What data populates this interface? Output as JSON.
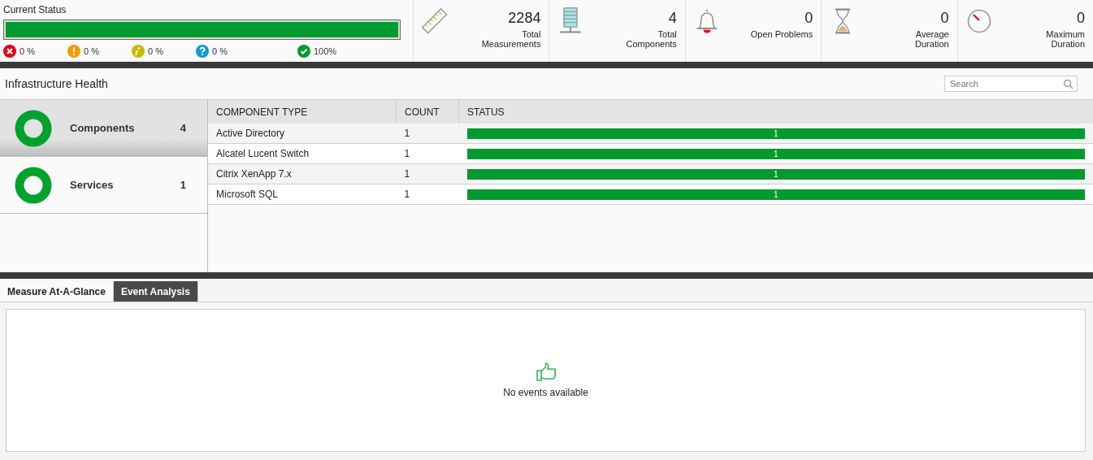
{
  "current_status": {
    "title": "Current Status",
    "level": 1,
    "legend": [
      {
        "kind": "critical",
        "text": "0 %"
      },
      {
        "kind": "major",
        "text": "0 %"
      },
      {
        "kind": "minor",
        "text": "0 %"
      },
      {
        "kind": "unknown",
        "text": "0 %"
      },
      {
        "kind": "normal",
        "text": "100%"
      }
    ]
  },
  "stats": [
    {
      "kind": "ruler",
      "value": "2284",
      "label": "Total Measurements"
    },
    {
      "kind": "server",
      "value": "4",
      "label": "Total Components"
    },
    {
      "kind": "bell",
      "value": "0",
      "label": "Open Problems"
    },
    {
      "kind": "hourglass",
      "value": "0",
      "label": "Average Duration"
    },
    {
      "kind": "gauge",
      "value": "0",
      "label": "Maximum Duration"
    }
  ],
  "infrastructure_health": {
    "title": "Infrastructure Health",
    "search": {
      "placeholder": "Search"
    },
    "sidebar": {
      "items": [
        {
          "label": "Components",
          "count": "4",
          "selected": true
        },
        {
          "label": "Services",
          "count": "1",
          "selected": false
        }
      ]
    },
    "table": {
      "columns": [
        "COMPONENT TYPE",
        "COUNT",
        "STATUS"
      ],
      "rows": [
        {
          "type": "Active Directory",
          "count": "1",
          "status": "1",
          "level": 1
        },
        {
          "type": "Alcatel Lucent Switch",
          "count": "1",
          "status": "1",
          "level": 1
        },
        {
          "type": "Citrix XenApp 7.x",
          "count": "1",
          "status": "1",
          "level": 1
        },
        {
          "type": "Microsoft SQL",
          "count": "1",
          "status": "1",
          "level": 1
        }
      ]
    }
  },
  "tabs": [
    {
      "label": "Measure At-A-Glance",
      "selected": false
    },
    {
      "label": "Event Analysis",
      "selected": true
    }
  ],
  "events": {
    "message": "No events available"
  }
}
